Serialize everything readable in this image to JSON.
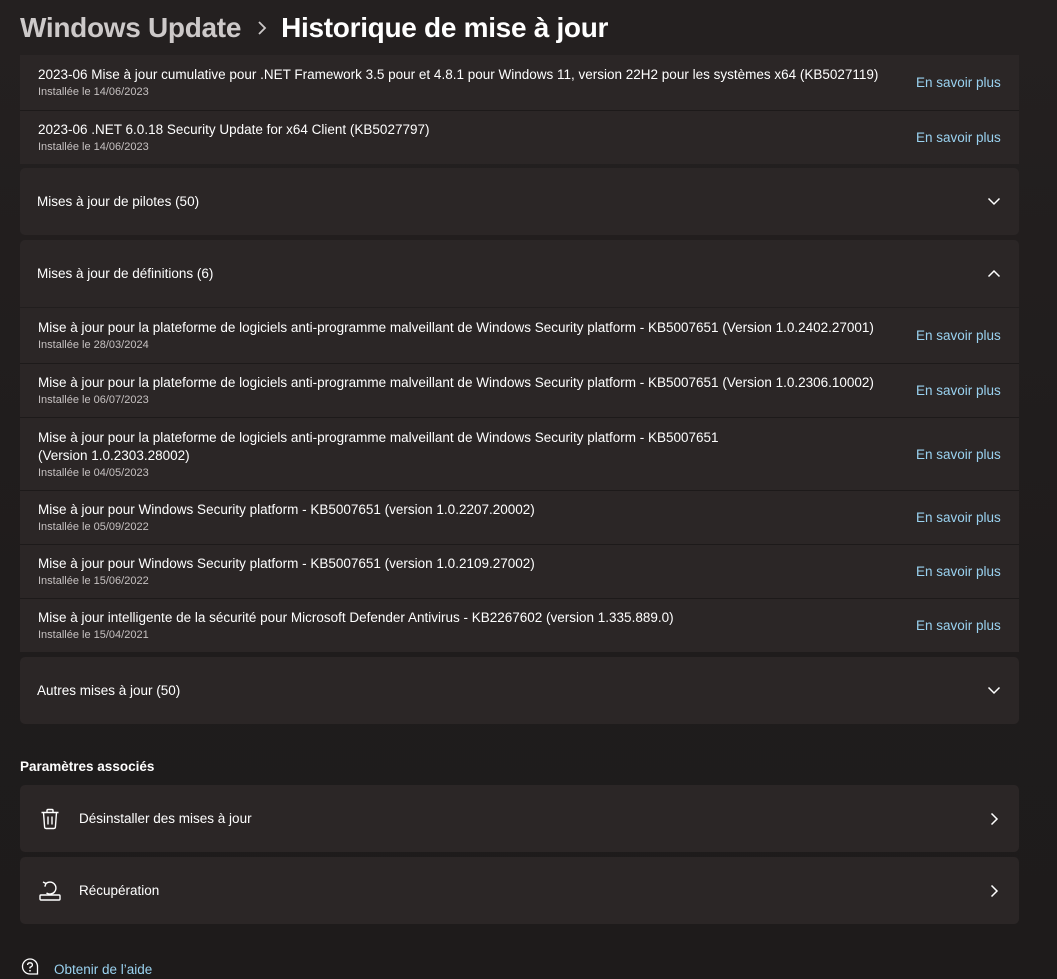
{
  "breadcrumb": {
    "parent": "Windows Update",
    "current": "Historique de mise à jour"
  },
  "learn_more_label": "En savoir plus",
  "top_updates": [
    {
      "title": "2023-06 Mise à jour cumulative pour .NET Framework 3.5 pour et 4.8.1 pour Windows 11, version 22H2 pour les systèmes x64 (KB5027119)",
      "date": "Installée le 14/06/2023"
    },
    {
      "title": "2023-06 .NET 6.0.18 Security Update for x64 Client (KB5027797)",
      "date": "Installée le 14/06/2023"
    }
  ],
  "sections": {
    "drivers": {
      "label": "Mises à jour de pilotes (50)",
      "expanded": false
    },
    "definitions": {
      "label": "Mises à jour de définitions (6)",
      "expanded": true
    },
    "other": {
      "label": "Autres mises à jour (50)",
      "expanded": false
    }
  },
  "definition_updates": [
    {
      "title": "Mise à jour pour la plateforme de logiciels anti-programme malveillant de Windows Security platform - KB5007651 (Version 1.0.2402.27001)",
      "date": "Installée le 28/03/2024"
    },
    {
      "title": "Mise à jour pour la plateforme de logiciels anti-programme malveillant de Windows Security platform - KB5007651 (Version 1.0.2306.10002)",
      "date": "Installée le 06/07/2023"
    },
    {
      "title": "Mise à jour pour la plateforme de logiciels anti-programme malveillant de Windows Security platform - KB5007651",
      "title_line2": "(Version 1.0.2303.28002)",
      "date": "Installée le 04/05/2023"
    },
    {
      "title": "Mise à jour pour Windows Security platform - KB5007651 (version 1.0.2207.20002)",
      "date": "Installée le 05/09/2022"
    },
    {
      "title": "Mise à jour pour Windows Security platform - KB5007651 (version 1.0.2109.27002)",
      "date": "Installée le 15/06/2022"
    },
    {
      "title": "Mise à jour intelligente de la sécurité pour Microsoft Defender Antivirus - KB2267602 (version 1.335.889.0)",
      "date": "Installée le 15/04/2021"
    }
  ],
  "related": {
    "title": "Paramètres associés",
    "uninstall": {
      "label": "Désinstaller des mises à jour",
      "icon": "trash-icon"
    },
    "recovery": {
      "label": "Récupération",
      "icon": "recovery-icon"
    }
  },
  "help": {
    "label": "Obtenir de l’aide",
    "icon": "help-icon"
  },
  "colors": {
    "background": "#1f1c1c",
    "card": "#2b2626",
    "link": "#9ad2f0"
  }
}
